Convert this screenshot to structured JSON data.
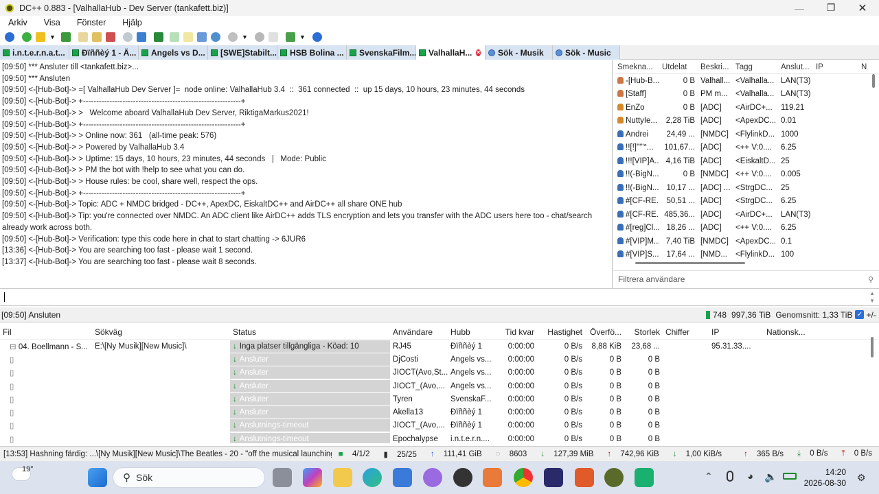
{
  "window": {
    "title": "DC++ 0.883 - [ValhallaHub - Dev Server (tankafett.biz)]"
  },
  "menu": [
    "Arkiv",
    "Visa",
    "Fönster",
    "Hjälp"
  ],
  "tabs": [
    {
      "label": "i.n.t.e.r.n.a.t...",
      "type": "hub"
    },
    {
      "label": "Ðïññèý 1 - Ä...",
      "type": "hub"
    },
    {
      "label": "Angels vs D...",
      "type": "hub"
    },
    {
      "label": "[SWE]Stabilt...",
      "type": "hub"
    },
    {
      "label": "HSB Bolina ...",
      "type": "hub"
    },
    {
      "label": "SvenskaFilm...",
      "type": "hub"
    },
    {
      "label": "ValhallaH...",
      "type": "hub",
      "active": true
    },
    {
      "label": "Sök - Musik",
      "type": "search"
    },
    {
      "label": "Sök - Music",
      "type": "search"
    }
  ],
  "chat": [
    "[09:50] *** Ansluter till <tankafett.biz>...",
    "[09:50] *** Ansluten",
    "[09:50] <-[Hub-Bot]-> =[ ValhallaHub Dev Server ]=  node online: ValhallaHub 3.4  ::  361 connected  ::  up 15 days, 10 hours, 23 minutes, 44 seconds",
    "[09:50] <-[Hub-Bot]-> +------------------------------------------------------------+",
    "[09:50] <-[Hub-Bot]-> >   Welcome aboard ValhallaHub Dev Server, RiktigaMarkus2021!",
    "[09:50] <-[Hub-Bot]-> +------------------------------------------------------------+",
    "[09:50] <-[Hub-Bot]-> > Online now: 361   (all-time peak: 576)",
    "[09:50] <-[Hub-Bot]-> > Powered by ValhallaHub 3.4",
    "[09:50] <-[Hub-Bot]-> > Uptime: 15 days, 10 hours, 23 minutes, 44 seconds   |   Mode: Public",
    "[09:50] <-[Hub-Bot]-> > PM the bot with !help to see what you can do.",
    "[09:50] <-[Hub-Bot]-> > House rules: be cool, share well, respect the ops.",
    "[09:50] <-[Hub-Bot]-> +------------------------------------------------------------+",
    "[09:50] <-[Hub-Bot]-> Topic: ADC + NMDC bridged - DC++, ApexDC, EiskaltDC++ and AirDC++ all share ONE hub",
    "[09:50] <-[Hub-Bot]-> Tip: you're connected over NMDC. An ADC client like AirDC++ adds TLS encryption and lets you transfer with the ADC users here too - chat/search already work across both.",
    "[09:50] <-[Hub-Bot]-> Verification: type this code here in chat to start chatting -> 6JUR6",
    "[13:36] <-[Hub-Bot]-> You are searching too fast - please wait 1 second.",
    "[13:37] <-[Hub-Bot]-> You are searching too fast - please wait 8 seconds."
  ],
  "userlist": {
    "columns": [
      "Smekna...",
      "Utdelat",
      "Beskri...",
      "Tagg",
      "Anslut...",
      "IP",
      "N"
    ],
    "rows": [
      {
        "icon": "op",
        "nick": "-[Hub-B...",
        "share": "0 B",
        "desc": "Valhall...",
        "tag": "<Valhalla...",
        "conn": "LAN(T3)"
      },
      {
        "icon": "op",
        "nick": "[Staff]",
        "share": "0 B",
        "desc": "PM m...",
        "tag": "<Valhalla...",
        "conn": "LAN(T3)"
      },
      {
        "icon": "user-orange",
        "nick": "EnZo",
        "share": "0 B",
        "desc": "[ADC]",
        "tag": "<AirDC+...",
        "conn": "119.21"
      },
      {
        "icon": "user-orange",
        "nick": "NuttyIe...",
        "share": "2,28 TiB",
        "desc": "[ADC]",
        "tag": "<ApexDC...",
        "conn": "0.01"
      },
      {
        "icon": "user",
        "nick": "Andrei",
        "share": "24,49 ...",
        "desc": "[NMDC]",
        "tag": "<FlylinkD...",
        "conn": "1000"
      },
      {
        "icon": "user",
        "nick": "!![!]'\"\"°...",
        "share": "101,67...",
        "desc": "[ADC]",
        "tag": "<++ V:0....",
        "conn": "6.25"
      },
      {
        "icon": "user",
        "nick": "!!![VIP]A...",
        "share": "4,16 TiB",
        "desc": "[ADC]",
        "tag": "<EiskaltD...",
        "conn": "25"
      },
      {
        "icon": "user",
        "nick": "!!(-BigN...",
        "share": "0 B",
        "desc": "[NMDC]",
        "tag": "<++ V:0....",
        "conn": "0.005"
      },
      {
        "icon": "user",
        "nick": "!!(-BigN...",
        "share": "10,17 ...",
        "desc": "[ADC] ...",
        "tag": "<StrgDC...",
        "conn": "25"
      },
      {
        "icon": "user",
        "nick": "#[CF-RE...",
        "share": "50,51 ...",
        "desc": "[ADC]",
        "tag": "<StrgDC...",
        "conn": "6.25"
      },
      {
        "icon": "user",
        "nick": "#[CF-RE...",
        "share": "485,36...",
        "desc": "[ADC]",
        "tag": "<AirDC+...",
        "conn": "LAN(T3)"
      },
      {
        "icon": "user",
        "nick": "#[reg]Cl...",
        "share": "18,26 ...",
        "desc": "[ADC]",
        "tag": "<++ V:0....",
        "conn": "6.25"
      },
      {
        "icon": "user",
        "nick": "#[VIP]M...",
        "share": "7,40 TiB",
        "desc": "[NMDC]",
        "tag": "<ApexDC...",
        "conn": "0.1"
      },
      {
        "icon": "user",
        "nick": "#[VIP]S...",
        "share": "17,64 ...",
        "desc": "[NMD...",
        "tag": "<FlylinkD...",
        "conn": "100"
      }
    ],
    "filter_placeholder": "Filtrera användare"
  },
  "hub_status": {
    "left": "[09:50] Ansluten",
    "users": "748",
    "share": "997,36 TiB",
    "average": "Genomsnitt: 1,33 TiB",
    "toggle": "+/-"
  },
  "transfers": {
    "columns": [
      "Fil",
      "Sökväg",
      "Status",
      "Användare",
      "Hubb",
      "Tid kvar",
      "Hastighet",
      "Överfö...",
      "Storlek",
      "Chiffer",
      "IP",
      "Nationsk..."
    ],
    "rows": [
      {
        "file": "04. Boellmann - S...",
        "path": "E:\\[Ny Musik][New Music]\\",
        "status": "Inga platser tillgängliga - Köad: 10",
        "user": "RJ45",
        "hub": "Ðïññèý 1",
        "time": "0:00:00",
        "speed": "0 B/s",
        "transferred": "8,88 KiB",
        "size": "23,68 ...",
        "cipher": "",
        "ip": "95.31.33....",
        "country": ""
      },
      {
        "file": "",
        "path": "",
        "status": "Ansluter",
        "user": "DjCosti",
        "hub": "Angels vs...",
        "time": "0:00:00",
        "speed": "0 B/s",
        "transferred": "0 B",
        "size": "0 B",
        "cipher": "",
        "ip": "",
        "country": ""
      },
      {
        "file": "",
        "path": "",
        "status": "Ansluter",
        "user": "JIOCT(Avo,St...",
        "hub": "Angels vs...",
        "time": "0:00:00",
        "speed": "0 B/s",
        "transferred": "0 B",
        "size": "0 B",
        "cipher": "",
        "ip": "",
        "country": ""
      },
      {
        "file": "",
        "path": "",
        "status": "Ansluter",
        "user": "JIOCT_(Avo,...",
        "hub": "Angels vs...",
        "time": "0:00:00",
        "speed": "0 B/s",
        "transferred": "0 B",
        "size": "0 B",
        "cipher": "",
        "ip": "",
        "country": ""
      },
      {
        "file": "",
        "path": "",
        "status": "Ansluter",
        "user": "Tyren",
        "hub": "SvenskaF...",
        "time": "0:00:00",
        "speed": "0 B/s",
        "transferred": "0 B",
        "size": "0 B",
        "cipher": "",
        "ip": "",
        "country": ""
      },
      {
        "file": "",
        "path": "",
        "status": "Ansluter",
        "user": "Akella13",
        "hub": "Ðïññèý 1",
        "time": "0:00:00",
        "speed": "0 B/s",
        "transferred": "0 B",
        "size": "0 B",
        "cipher": "",
        "ip": "",
        "country": ""
      },
      {
        "file": "",
        "path": "",
        "status": "Anslutnings-timeout",
        "user": "JIOCT_(Avo,...",
        "hub": "Ðïññèý 1",
        "time": "0:00:00",
        "speed": "0 B/s",
        "transferred": "0 B",
        "size": "0 B",
        "cipher": "",
        "ip": "",
        "country": ""
      },
      {
        "file": "",
        "path": "",
        "status": "Anslutnings-timeout",
        "user": "Epochalypse",
        "hub": "i.n.t.e.r.n....",
        "time": "0:00:00",
        "speed": "0 B/s",
        "transferred": "0 B",
        "size": "0 B",
        "cipher": "",
        "ip": "",
        "country": ""
      }
    ]
  },
  "bottom_status": {
    "message": "[13:53] Hashning färdig: ...\\[Ny Musik][New Music]\\The Beatles - 20 - \"off the musical launching pad we went\".mp3",
    "hubs": "4/1/2",
    "slots": "25/25",
    "shared": "111,41 GiB",
    "files": "8603",
    "down_total": "127,39 MiB",
    "up_total": "742,96 KiB",
    "down_speed": "1,00 KiB/s",
    "up_speed": "365 B/s",
    "down_limit": "0 B/s",
    "up_limit": "0 B/s"
  },
  "taskbar": {
    "temperature": "19°",
    "search": "Sök",
    "time": "14:20",
    "date": "2026-08-30"
  },
  "colors": {
    "accent": "#1aa34a",
    "tab_bg": "#d9e4f2",
    "status_gray": "#d4d4d4",
    "taskbar": "#dde3ee"
  }
}
